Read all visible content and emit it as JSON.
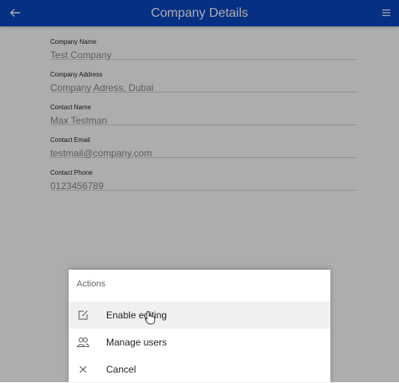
{
  "appbar": {
    "title": "Company Details",
    "back_icon": "arrow-left-icon",
    "menu_icon": "hamburger-menu-icon",
    "color": "#0a47c2"
  },
  "fields": [
    {
      "label": "Company Name",
      "value": "Test Company"
    },
    {
      "label": "Company Address",
      "value": "Company Adress, Dubai"
    },
    {
      "label": "Contact Name",
      "value": "Max Testman"
    },
    {
      "label": "Contact Email",
      "value": "testmail@company.com"
    },
    {
      "label": "Contact Phone",
      "value": "0123456789"
    }
  ],
  "actions_sheet": {
    "title": "Actions",
    "items": [
      {
        "label": "Enable editing",
        "icon": "edit-icon"
      },
      {
        "label": "Manage users",
        "icon": "users-icon"
      },
      {
        "label": "Cancel",
        "icon": "close-icon"
      }
    ]
  }
}
